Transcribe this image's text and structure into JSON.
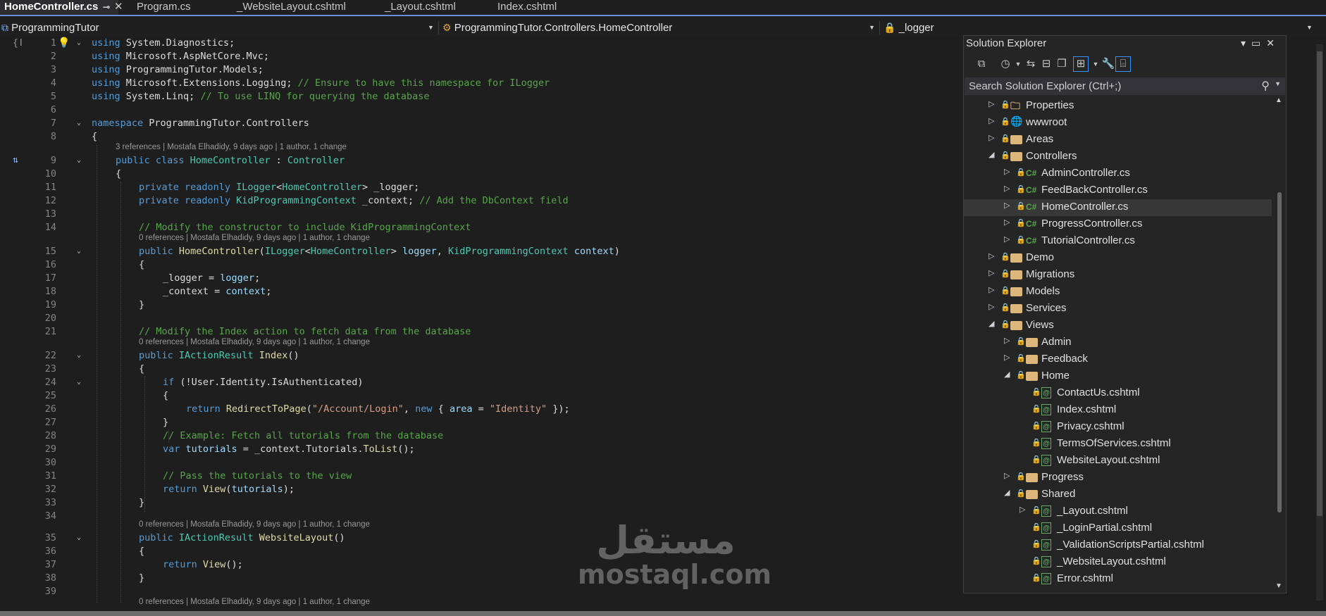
{
  "tabs": [
    {
      "label": "HomeController.cs",
      "active": true
    },
    {
      "label": "Program.cs"
    },
    {
      "label": "_WebsiteLayout.cshtml"
    },
    {
      "label": "_Layout.cshtml"
    },
    {
      "label": "Index.cshtml"
    }
  ],
  "navbar": {
    "project": "ProgrammingTutor",
    "class_path": "ProgrammingTutor.Controllers.HomeController",
    "member": "_logger"
  },
  "editor": {
    "lines": [
      {
        "n": "1"
      },
      {
        "n": "2"
      },
      {
        "n": "3"
      },
      {
        "n": "4"
      },
      {
        "n": "5"
      },
      {
        "n": "6"
      },
      {
        "n": "7"
      },
      {
        "n": "8"
      },
      {
        "n": "9"
      },
      {
        "n": "10"
      },
      {
        "n": "11"
      },
      {
        "n": "12"
      },
      {
        "n": "13"
      },
      {
        "n": "14"
      },
      {
        "n": "15"
      },
      {
        "n": "16"
      },
      {
        "n": "17"
      },
      {
        "n": "18"
      },
      {
        "n": "19"
      },
      {
        "n": "20"
      },
      {
        "n": "21"
      },
      {
        "n": "22"
      },
      {
        "n": "23"
      },
      {
        "n": "24"
      },
      {
        "n": "25"
      },
      {
        "n": "26"
      },
      {
        "n": "27"
      },
      {
        "n": "28"
      },
      {
        "n": "29"
      },
      {
        "n": "30"
      },
      {
        "n": "31"
      },
      {
        "n": "32"
      },
      {
        "n": "33"
      },
      {
        "n": "34"
      },
      {
        "n": "35"
      },
      {
        "n": "36"
      },
      {
        "n": "37"
      },
      {
        "n": "38"
      },
      {
        "n": "39"
      }
    ],
    "code": {
      "l1_kw": "using",
      "l1_rest": " System.Diagnostics;",
      "l2_kw": "using",
      "l2_rest": " Microsoft.AspNetCore.Mvc;",
      "l3_kw": "using",
      "l3_rest": " ProgrammingTutor.Models;",
      "l4_kw": "using",
      "l4_rest": " Microsoft.Extensions.Logging; ",
      "l4_cm": "// Ensure to have this namespace for ILogger",
      "l5_kw": "using",
      "l5_rest": " System.Linq; ",
      "l5_cm": "// To use LINQ for querying the database",
      "l7_kw": "namespace",
      "l7_rest": " ProgrammingTutor.Controllers",
      "brace_open": "{",
      "brace_close": "}",
      "l9_kw": "public class ",
      "l9_ty": "HomeController",
      "l9_rest": " : ",
      "l9_base": "Controller",
      "l11_kw": "private readonly ",
      "l11_ty": "ILogger",
      "l11_lt": "<",
      "l11_ty2": "HomeController",
      "l11_rest": "> _logger;",
      "l12_kw": "private readonly ",
      "l12_ty": "KidProgrammingContext",
      "l12_rest": " _context; ",
      "l12_cm": "// Add the DbContext field",
      "l14_cm": "// Modify the constructor to include KidProgrammingContext",
      "l15_kw": "public ",
      "l15_fn": "HomeController",
      "l15_a": "(",
      "l15_ty": "ILogger",
      "l15_b": "<",
      "l15_ty2": "HomeController",
      "l15_c": "> ",
      "l15_id": "logger",
      "l15_d": ", ",
      "l15_ty3": "KidProgrammingContext",
      "l15_e": " ",
      "l15_id2": "context",
      "l15_f": ")",
      "l17_a": "_logger = ",
      "l17_id": "logger",
      "l17_b": ";",
      "l18_a": "_context = ",
      "l18_id": "context",
      "l18_b": ";",
      "l21_cm": "// Modify the Index action to fetch data from the database",
      "l22_kw": "public ",
      "l22_ty": "IActionResult",
      "l22_fn": " Index",
      "l22_rest": "()",
      "l24_kw": "if",
      "l24_rest": " (!User.Identity.IsAuthenticated)",
      "l26_kw": "return ",
      "l26_fn": "RedirectToPage",
      "l26_a": "(",
      "l26_st": "\"/Account/Login\"",
      "l26_b": ", ",
      "l26_kw2": "new",
      "l26_c": " { ",
      "l26_id": "area",
      "l26_d": " = ",
      "l26_st2": "\"Identity\"",
      "l26_e": " });",
      "l28_cm": "// Example: Fetch all tutorials from the database",
      "l29_kw": "var ",
      "l29_id": "tutorials",
      "l29_rest": " = _context.Tutorials.",
      "l29_fn": "ToList",
      "l29_end": "();",
      "l31_cm": "// Pass the tutorials to the view",
      "l32_kw": "return ",
      "l32_fn": "View",
      "l32_a": "(",
      "l32_id": "tutorials",
      "l32_b": ");",
      "l35_kw": "public ",
      "l35_ty": "IActionResult",
      "l35_fn": " WebsiteLayout",
      "l35_rest": "()",
      "l37_kw": "return ",
      "l37_fn": "View",
      "l37_rest": "();"
    },
    "codelens": {
      "c9": "3 references | Mostafa Elhadidy, 9 days ago | 1 author, 1 change",
      "c15": "0 references | Mostafa Elhadidy, 9 days ago | 1 author, 1 change",
      "c22": "0 references | Mostafa Elhadidy, 9 days ago | 1 author, 1 change",
      "c35": "0 references | Mostafa Elhadidy, 9 days ago | 1 author, 1 change",
      "c40": "0 references | Mostafa Elhadidy, 9 days ago | 1 author, 1 change"
    }
  },
  "solution_explorer": {
    "title": "Solution Explorer",
    "search_placeholder": "Search Solution Explorer (Ctrl+;)",
    "nodes": [
      {
        "label": "Properties",
        "icon": "properties-icon",
        "expander": "collapsed"
      },
      {
        "label": "wwwroot",
        "icon": "globe-icon",
        "expander": "collapsed"
      },
      {
        "label": "Areas",
        "icon": "folder-icon",
        "expander": "collapsed"
      },
      {
        "label": "Controllers",
        "icon": "folder-icon",
        "expander": "expanded"
      },
      {
        "label": "AdminController.cs",
        "icon": "csharp-file-icon",
        "expander": "collapsed"
      },
      {
        "label": "FeedBackController.cs",
        "icon": "csharp-file-icon",
        "expander": "collapsed"
      },
      {
        "label": "HomeController.cs",
        "icon": "csharp-file-icon",
        "expander": "collapsed",
        "selected": true
      },
      {
        "label": "ProgressController.cs",
        "icon": "csharp-file-icon",
        "expander": "collapsed"
      },
      {
        "label": "TutorialController.cs",
        "icon": "csharp-file-icon",
        "expander": "collapsed"
      },
      {
        "label": "Demo",
        "icon": "folder-icon",
        "expander": "collapsed"
      },
      {
        "label": "Migrations",
        "icon": "folder-icon",
        "expander": "collapsed"
      },
      {
        "label": "Models",
        "icon": "folder-icon",
        "expander": "collapsed"
      },
      {
        "label": "Services",
        "icon": "folder-icon",
        "expander": "collapsed"
      },
      {
        "label": "Views",
        "icon": "folder-icon",
        "expander": "expanded"
      },
      {
        "label": "Admin",
        "icon": "folder-icon",
        "expander": "collapsed"
      },
      {
        "label": "Feedback",
        "icon": "folder-icon",
        "expander": "collapsed"
      },
      {
        "label": "Home",
        "icon": "folder-icon",
        "expander": "expanded"
      },
      {
        "label": "ContactUs.cshtml",
        "icon": "razor-file-icon",
        "expander": "none"
      },
      {
        "label": "Index.cshtml",
        "icon": "razor-file-icon",
        "expander": "none"
      },
      {
        "label": "Privacy.cshtml",
        "icon": "razor-file-icon",
        "expander": "none"
      },
      {
        "label": "TermsOfServices.cshtml",
        "icon": "razor-file-icon",
        "expander": "none"
      },
      {
        "label": "WebsiteLayout.cshtml",
        "icon": "razor-file-icon",
        "expander": "none"
      },
      {
        "label": "Progress",
        "icon": "folder-icon",
        "expander": "collapsed"
      },
      {
        "label": "Shared",
        "icon": "folder-icon",
        "expander": "expanded"
      },
      {
        "label": "_Layout.cshtml",
        "icon": "razor-file-icon",
        "expander": "collapsed"
      },
      {
        "label": "_LoginPartial.cshtml",
        "icon": "razor-file-icon",
        "expander": "none"
      },
      {
        "label": "_ValidationScriptsPartial.cshtml",
        "icon": "razor-file-icon",
        "expander": "none"
      },
      {
        "label": "_WebsiteLayout.cshtml",
        "icon": "razor-file-icon",
        "expander": "none"
      },
      {
        "label": "Error.cshtml",
        "icon": "razor-file-icon",
        "expander": "none"
      }
    ]
  },
  "watermark": {
    "arabic": "مستقل",
    "latin": "mostaql.com"
  },
  "colors": {
    "accent": "#3794ff",
    "keyword": "#569cd6",
    "type": "#4ec9b0",
    "comment": "#57a64a",
    "string": "#d69d85"
  }
}
